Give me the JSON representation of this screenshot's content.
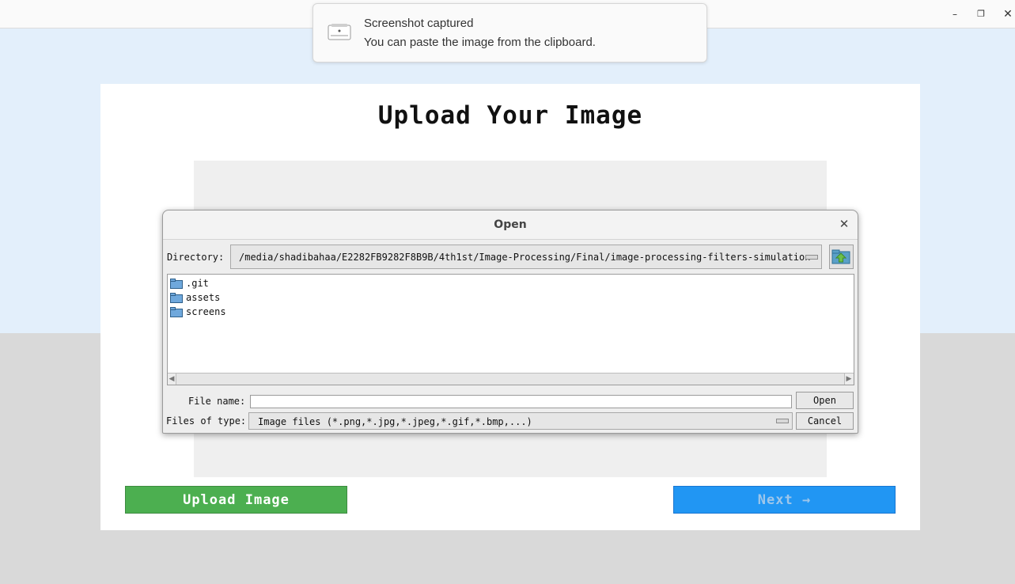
{
  "window": {
    "controls": {
      "minimize_icon": "–",
      "maximize_icon": "❐",
      "close_icon": "✕"
    }
  },
  "notification": {
    "icon": "screenshot-icon",
    "title": "Screenshot captured",
    "body": "You can paste the image from the clipboard."
  },
  "app": {
    "title": "Upload Your Image",
    "upload_button": "Upload Image",
    "next_button": "Next →",
    "colors": {
      "upload": "#4caf50",
      "next": "#2196f3"
    }
  },
  "dialog": {
    "title": "Open",
    "close_icon": "✕",
    "directory_label": "Directory:",
    "directory_path": "/media/shadibahaa/E2282FB9282F8B9B/4th1st/Image-Processing/Final/image-processing-filters-simulation",
    "files": [
      {
        "name": ".git",
        "icon": "folder-icon"
      },
      {
        "name": "assets",
        "icon": "folder-icon"
      },
      {
        "name": "screens",
        "icon": "folder-icon"
      }
    ],
    "file_name_label": "File name:",
    "file_name_value": "",
    "files_of_type_label": "Files of type:",
    "files_of_type_value": "Image files (*.png,*.jpg,*.jpeg,*.gif,*.bmp,...)",
    "open_button": "Open",
    "cancel_button": "Cancel"
  }
}
